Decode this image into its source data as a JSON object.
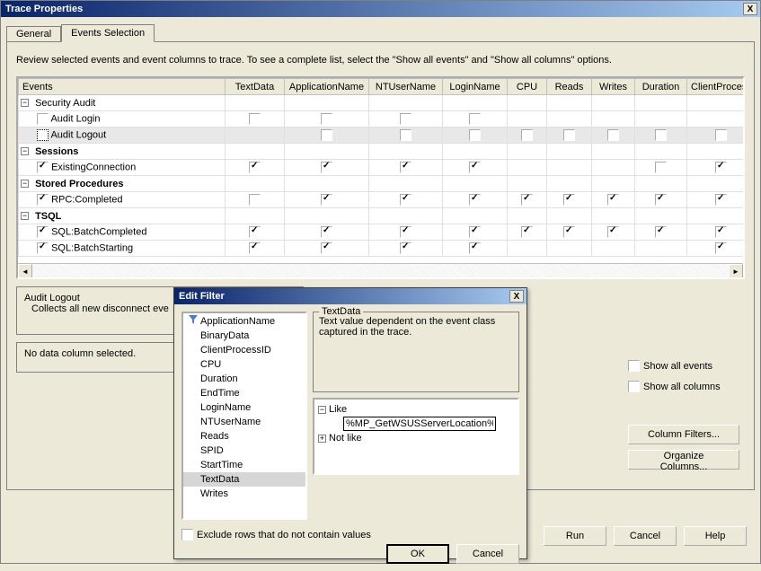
{
  "window": {
    "title": "Trace Properties",
    "close": "X"
  },
  "tabs": {
    "general": "General",
    "events": "Events Selection"
  },
  "instruction": "Review selected events and event columns to trace. To see a complete list, select the \"Show all events\" and \"Show all columns\" options.",
  "columns": [
    "Events",
    "TextData",
    "ApplicationName",
    "NTUserName",
    "LoginName",
    "CPU",
    "Reads",
    "Writes",
    "Duration",
    "ClientProcess"
  ],
  "rows": [
    {
      "type": "group",
      "label": "Security Audit"
    },
    {
      "type": "event",
      "label": "Audit Login",
      "checked": false,
      "cells": [
        false,
        false,
        false,
        false,
        null,
        null,
        null,
        null,
        null
      ]
    },
    {
      "type": "event",
      "label": "Audit Logout",
      "checked": false,
      "selected": true,
      "dashed": true,
      "cells": [
        null,
        false,
        false,
        false,
        false,
        false,
        false,
        false,
        false
      ]
    },
    {
      "type": "group",
      "label": "Sessions",
      "bold": true
    },
    {
      "type": "event",
      "label": "ExistingConnection",
      "checked": true,
      "cells": [
        true,
        true,
        true,
        true,
        null,
        null,
        null,
        false,
        true
      ]
    },
    {
      "type": "group",
      "label": "Stored Procedures",
      "bold": true
    },
    {
      "type": "event",
      "label": "RPC:Completed",
      "checked": true,
      "cells": [
        false,
        true,
        true,
        true,
        true,
        true,
        true,
        true,
        true
      ]
    },
    {
      "type": "group",
      "label": "TSQL",
      "bold": true
    },
    {
      "type": "event",
      "label": "SQL:BatchCompleted",
      "checked": true,
      "cells": [
        true,
        true,
        true,
        true,
        true,
        true,
        true,
        true,
        true
      ]
    },
    {
      "type": "event",
      "label": "SQL:BatchStarting",
      "checked": true,
      "cells": [
        true,
        true,
        true,
        true,
        null,
        null,
        null,
        null,
        true
      ]
    }
  ],
  "details": {
    "title": "Audit Logout",
    "desc": "Collects all new disconnect eve",
    "nocol": "No data column selected."
  },
  "options": {
    "show_events": "Show all events",
    "show_columns": "Show all columns",
    "col_filters": "Column Filters...",
    "org_columns": "Organize Columns..."
  },
  "buttons": {
    "run": "Run",
    "cancel": "Cancel",
    "help": "Help"
  },
  "dialog": {
    "title": "Edit Filter",
    "close": "X",
    "columns": [
      "ApplicationName",
      "BinaryData",
      "ClientProcessID",
      "CPU",
      "Duration",
      "EndTime",
      "LoginName",
      "NTUserName",
      "Reads",
      "SPID",
      "StartTime",
      "TextData",
      "Writes"
    ],
    "selected_col": "TextData",
    "filtered_col": "ApplicationName",
    "desc": {
      "legend": "TextData",
      "text": "Text value dependent on the event class captured in the trace."
    },
    "tree": {
      "like": "Like",
      "like_value": "%MP_GetWSUSServerLocation%",
      "notlike": "Not like"
    },
    "exclude": "Exclude rows that do not contain values",
    "ok": "OK",
    "cancel": "Cancel"
  }
}
